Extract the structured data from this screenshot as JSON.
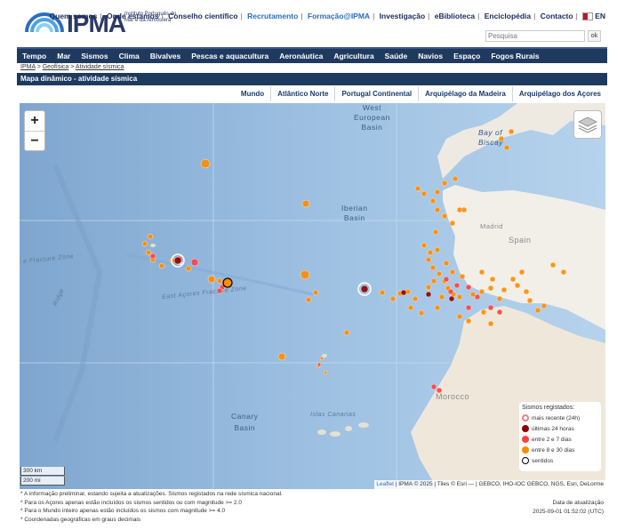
{
  "logo": {
    "text": "IPMA",
    "subtitle": "Instituto Português do Mar e da Atmosfera"
  },
  "top_links": [
    "Quem somos",
    "Onde estamos",
    "Conselho científico",
    "Recrutamento",
    "Formação@IPMA",
    "Investigação",
    "eBiblioteca",
    "Enciclopédia",
    "Contacto",
    "EN"
  ],
  "search": {
    "placeholder": "Pesquisa",
    "button": "ok"
  },
  "nav": [
    "Tempo",
    "Mar",
    "Sismos",
    "Clima",
    "Bivalves",
    "Pescas e aquacultura",
    "Aeronáutica",
    "Agricultura",
    "Saúde",
    "Navios",
    "Espaço",
    "Fogos Rurais"
  ],
  "breadcrumb": {
    "home": "IPMA",
    "section": "Geofísica",
    "page": "Atividade sísmica",
    "sep": ">"
  },
  "page_title": "Mapa dinâmico - atividade sísmica",
  "region_tabs": [
    "Mundo",
    "Atlântico Norte",
    "Portugal Continental",
    "Arquipélago da Madeira",
    "Arquipélago dos Açores"
  ],
  "map": {
    "zoom_in": "+",
    "zoom_out": "−",
    "labels": {
      "west_european": "West\nEuropean\nBasin",
      "bay_of_biscay": "Bay of\nBiscay",
      "iberian": "Iberian\nBasin",
      "madrid": "Madrid",
      "spain": "Spain",
      "morocco": "Morocco",
      "canary": "Canary\nBasin",
      "islas_canarias": "Islas Canarias",
      "east_azores": "East Açores Fracture Zone",
      "fracture_zone": "e Fracture Zone",
      "ridge": "Ridge"
    },
    "colors": {
      "ocean": "#9fc3e4",
      "land": "#f2efe9",
      "recent": "#ffffff",
      "day": "#8b0000",
      "week": "#ff4040",
      "month": "#ff8c00",
      "felt": "#000000"
    }
  },
  "legend": {
    "title": "Sismos registados:",
    "items": [
      {
        "label": "mais recente (24h)",
        "icon": "ring"
      },
      {
        "label": "últimas 24 horas",
        "icon": "darkred"
      },
      {
        "label": "entre 2 e 7 dias",
        "icon": "red"
      },
      {
        "label": "entre 8 e 30 dias",
        "icon": "orange"
      },
      {
        "label": "sentidos",
        "icon": "black-ring"
      }
    ]
  },
  "scale": {
    "km": "300 km",
    "mi": "200 mi"
  },
  "attribution": {
    "leaflet": "Leaflet",
    "rest": "| IPMA © 2025 | Tiles © Esri — | GEBCO, IHO-IOC GEBCO, NGS, Esri, DeLorme"
  },
  "notes": [
    "* A informação preliminar, estando sujeita a atualizações. Sismos registados na rede sísmica nacional.",
    "* Para os Açores apenas estão incluídos os sismos sentidos ou com magnitude >= 2.0",
    "* Para o Mundo inteiro apenas estão incluídos os sismos com magnitude >= 4.0",
    "* Coordenadas geográficas em graus decimais"
  ],
  "update": {
    "label": "Data de atualização",
    "value": "2025-09-01 01:52:02 (UTC)"
  }
}
